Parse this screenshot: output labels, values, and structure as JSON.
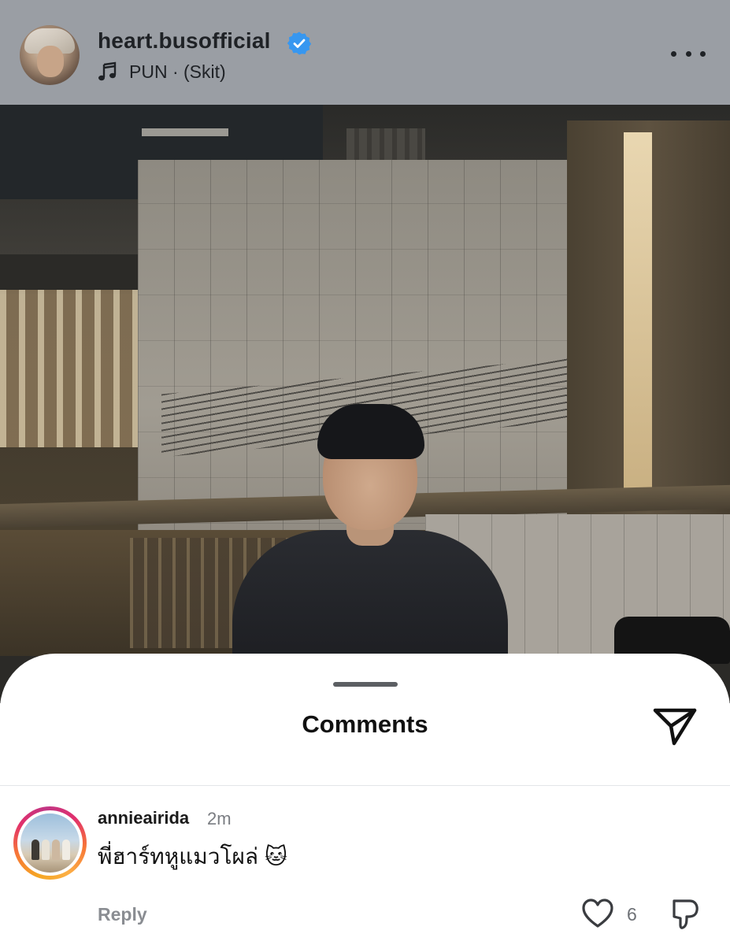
{
  "post": {
    "username": "heart.busofficial",
    "verified": true,
    "audio": "PUN · (Skit)",
    "icons": {
      "music": "music-note-icon",
      "more": "more-options-icon",
      "verified": "verified-badge-icon"
    }
  },
  "comments_sheet": {
    "title": "Comments",
    "share_icon": "send-icon",
    "comments": [
      {
        "username": "annieairida",
        "time": "2m",
        "text": "พี่ฮาร์ทหูแมวโผล่ 🐱",
        "reply_label": "Reply",
        "like_count": "6"
      }
    ]
  },
  "colors": {
    "header_overlay": "#9a9ea4",
    "verified_blue": "#3797f0",
    "text_primary": "#111111",
    "text_secondary": "#8a8d92"
  }
}
